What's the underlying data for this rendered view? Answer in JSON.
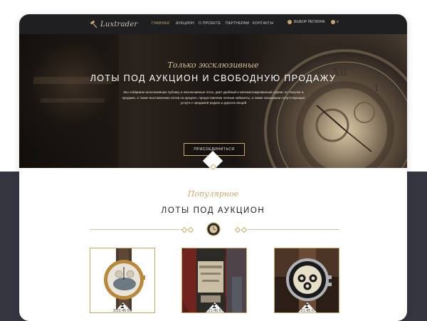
{
  "nav": {
    "logo_text": "Luxtrader",
    "items": [
      {
        "label": "ГЛАВНАЯ",
        "active": true
      },
      {
        "label": "АУКЦИОН",
        "active": false
      },
      {
        "label": "О ПРОЕКТЕ",
        "active": false
      },
      {
        "label": "ПАРТНЕРАМ",
        "active": false
      },
      {
        "label": "КОНТАКТЫ",
        "active": false
      }
    ],
    "region_label": "ВЫБОР РЕГИОНА",
    "lang_label": "≡",
    "region_icon": "pin-icon",
    "lang_icon": "globe-icon"
  },
  "hero": {
    "script": "Только эксклюзивные",
    "title": "ЛОТЫ ПОД АУКЦИОН И СВОБОДНУЮ ПРОДАЖУ",
    "text": "Мы собираем эксклюзивную публику и эксклюзивные лоты, дает удобный и автоматизированный сервис по покупке и продаже, а также выставлению лотов на аукцион, предоставляем личные кабинеты, а также оказываем сопутствующие услуги с продажей редких и дорогих вещей",
    "button_label": "ПРИСОЕДИНИТЬСЯ"
  },
  "popular": {
    "script": "Популярное",
    "title": "ЛОТЫ ПОД АУКЦИОН"
  },
  "lots": [
    {
      "name": "gold-chronograph-watch",
      "timer": "3:21:45:57"
    },
    {
      "name": "vintage-wine-bottle",
      "timer": "3:21:45:57"
    },
    {
      "name": "racing-chronograph-watch",
      "timer": "3:21:45:57"
    }
  ],
  "colors": {
    "accent": "#c7a96c",
    "nav_bg": "#1f1f22",
    "page_dark": "#363640"
  }
}
